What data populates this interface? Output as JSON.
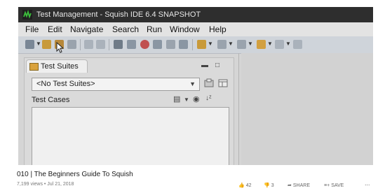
{
  "window": {
    "title": "Test Management - Squish IDE 6.4 SNAPSHOT"
  },
  "menu": [
    "File",
    "Edit",
    "Navigate",
    "Search",
    "Run",
    "Window",
    "Help"
  ],
  "panel": {
    "tab_label": "Test Suites",
    "suite_select_value": "<No Test Suites>",
    "test_cases_label": "Test Cases"
  },
  "video": {
    "title": "010 | The Beginners Guide To Squish",
    "meta": "7,199 views • Jul 21, 2018",
    "likes": "42",
    "dislikes": "3",
    "share_label": "SHARE",
    "save_label": "SAVE",
    "more_label": "..."
  },
  "colors": {
    "titlebar": "#2e2e2e",
    "toolbar": "#cfd4da",
    "menubar": "#e3e3e3",
    "squish_green": "#2f9a2f"
  }
}
